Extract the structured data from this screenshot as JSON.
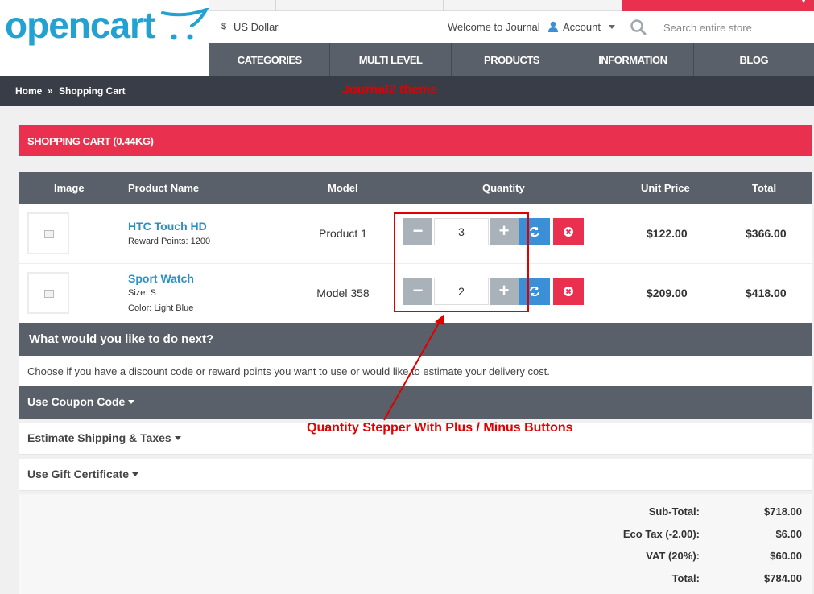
{
  "logo": {
    "text": "opencart"
  },
  "topbar": {
    "currency_symbol": "$",
    "currency": "US Dollar",
    "welcome": "Welcome to Journal",
    "account": "Account",
    "search_placeholder": "Search entire store"
  },
  "nav": {
    "items": [
      "CATEGORIES",
      "MULTI LEVEL",
      "PRODUCTS",
      "INFORMATION",
      "BLOG"
    ]
  },
  "breadcrumb": {
    "home": "Home",
    "separator": "»",
    "current": "Shopping Cart"
  },
  "theme_note": "Journal2 theme",
  "cart": {
    "title": "SHOPPING CART  (0.44KG)",
    "columns": {
      "image": "Image",
      "name": "Product Name",
      "model": "Model",
      "quantity": "Quantity",
      "unit_price": "Unit Price",
      "total": "Total"
    },
    "rows": [
      {
        "name": "HTC Touch HD",
        "options": [
          "Reward Points: 1200"
        ],
        "model": "Product 1",
        "quantity": "3",
        "unit_price": "$122.00",
        "total": "$366.00"
      },
      {
        "name": "Sport Watch",
        "options": [
          "Size: S",
          "Color: Light Blue"
        ],
        "model": "Model 358",
        "quantity": "2",
        "unit_price": "$209.00",
        "total": "$418.00"
      }
    ],
    "buttons": {
      "minus": "−",
      "plus": "+"
    }
  },
  "next": {
    "title": "What would you like to do next?",
    "description": "Choose if you have a discount code or reward points you want to use or would like to estimate your delivery cost.",
    "coupon": "Use Coupon Code",
    "shipping": "Estimate Shipping & Taxes",
    "gift": "Use Gift Certificate"
  },
  "annotation": "Quantity Stepper With Plus / Minus Buttons",
  "totals": [
    {
      "label": "Sub-Total:",
      "value": "$718.00"
    },
    {
      "label": "Eco Tax (-2.00):",
      "value": "$6.00"
    },
    {
      "label": "VAT (20%):",
      "value": "$60.00"
    },
    {
      "label": "Total:",
      "value": "$784.00"
    }
  ],
  "colors": {
    "accent_red": "#e9304e",
    "nav_gray": "#5a6069",
    "dark_bar": "#383d47",
    "link_blue": "#2a8fc7",
    "refresh_blue": "#3b8fd6",
    "logo_blue": "#23a1d1",
    "annotation_red": "#e00000"
  },
  "icons": [
    "cart-icon",
    "user-icon",
    "search-icon",
    "refresh-icon",
    "remove-icon",
    "image-placeholder-icon"
  ]
}
